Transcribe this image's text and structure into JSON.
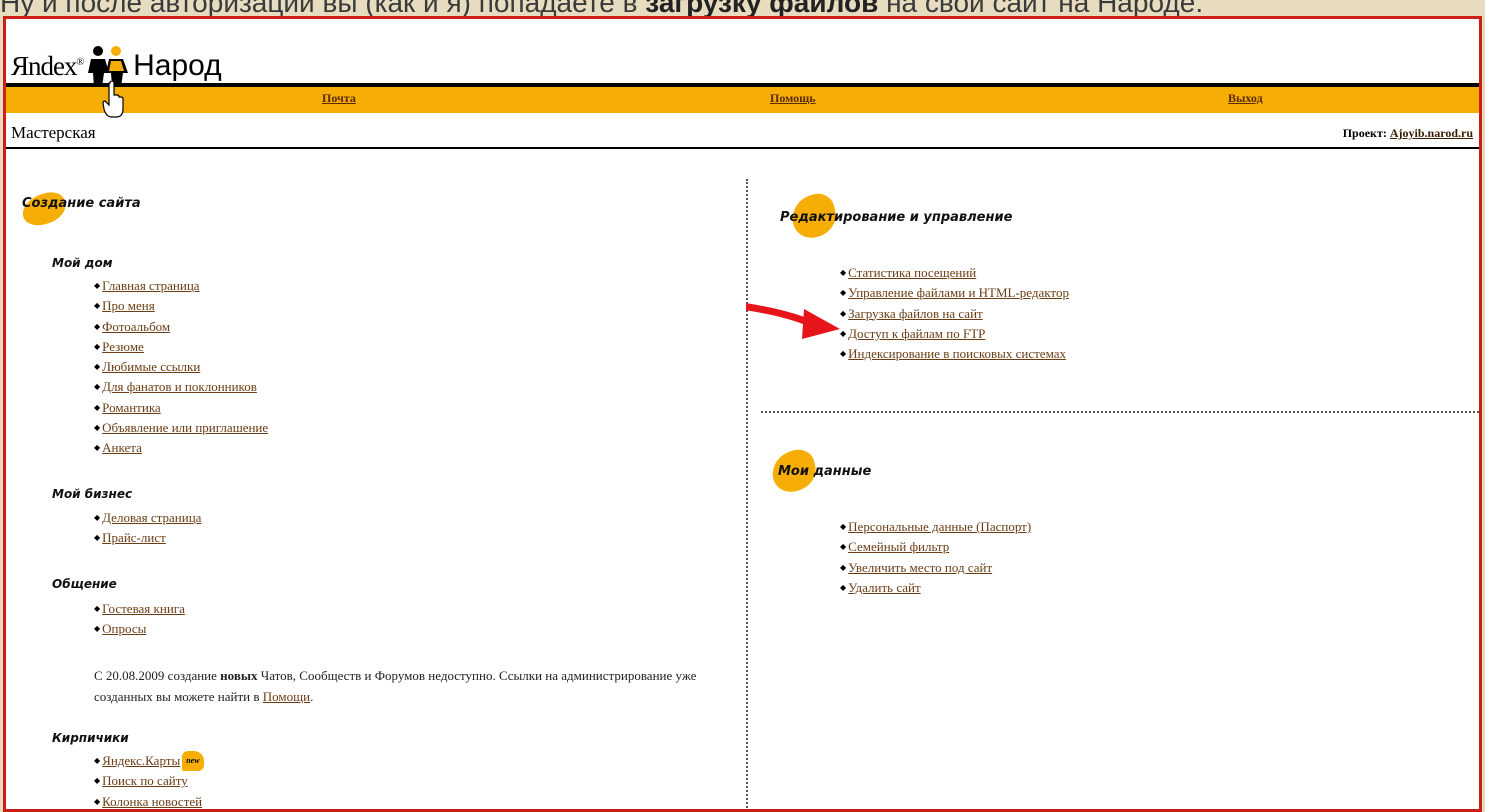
{
  "caption": "Ну и после авторизации вы (как и я) попадаете в ",
  "caption_bold": "загрузку файлов",
  "caption_tail": " на свой сайт на Народе.",
  "logo": {
    "yandex": "Яndex",
    "reg": "®",
    "narod": "Народ"
  },
  "topbar": {
    "mail": "Почта",
    "help": "Помощь",
    "exit": "Выход"
  },
  "subbar": {
    "title": "Мастерская",
    "project_label": "Проект: ",
    "project_link": "Ajoyib.narod.ru"
  },
  "left": {
    "heading": "Создание сайта",
    "groups": [
      {
        "title": "Мой дом",
        "links": [
          "Главная страница",
          "Про меня",
          "Фотоальбом",
          "Резюме",
          "Любимые ссылки",
          "Для фанатов и поклонников",
          "Романтика",
          "Объявление или приглашение",
          "Анкета"
        ]
      },
      {
        "title": "Мой бизнес",
        "links": [
          "Деловая страница",
          "Прайс-лист"
        ]
      },
      {
        "title": "Общение",
        "links": [
          "Гостевая книга",
          "Опросы"
        ]
      },
      {
        "title": "Кирпичики",
        "links": [
          "Яндекс.Карты",
          "Поиск по сайту",
          "Колонка новостей"
        ]
      }
    ],
    "note_prefix": "С 20.08.2009 создание ",
    "note_bold": "новых",
    "note_mid": " Чатов, Сообществ и Форумов недоступно. Ссылки на администрирование уже созданных вы можете найти в ",
    "note_link": "Помощи",
    "note_end": ".",
    "new_badge": "new"
  },
  "right": {
    "edit_heading": "Редактирование и управление",
    "edit_links": [
      "Статистика посещений",
      "Управление файлами и HTML-редактор",
      "Загрузка файлов на сайт",
      "Доступ к файлам по FTP",
      "Индексирование в поисковых системах"
    ],
    "data_heading": "Мои данные",
    "data_links": [
      "Персональные данные (Паспорт)",
      "Семейный фильтр",
      "Увеличить место под сайт",
      "Удалить сайт"
    ]
  },
  "colors": {
    "accent": "#f6ae07",
    "frame": "#cc1f16",
    "link": "#6b3d14",
    "arrow": "#e8141b"
  }
}
